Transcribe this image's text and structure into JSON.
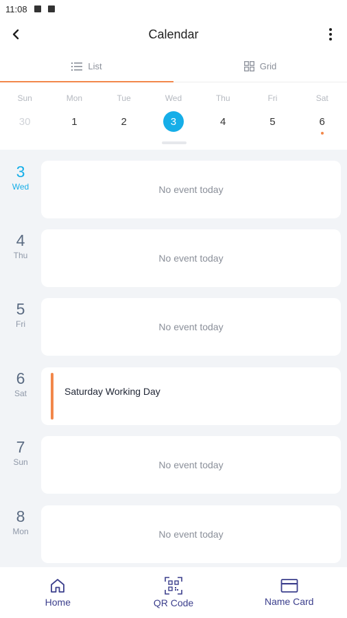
{
  "status_bar": {
    "time": "11:08"
  },
  "header": {
    "title": "Calendar"
  },
  "view_tabs": [
    {
      "label": "List",
      "icon": "list-icon",
      "active": true
    },
    {
      "label": "Grid",
      "icon": "grid-icon",
      "active": false
    }
  ],
  "week_strip": {
    "days": [
      {
        "name": "Sun",
        "date": "30",
        "muted": true
      },
      {
        "name": "Mon",
        "date": "1"
      },
      {
        "name": "Tue",
        "date": "2"
      },
      {
        "name": "Wed",
        "date": "3",
        "selected": true
      },
      {
        "name": "Thu",
        "date": "4"
      },
      {
        "name": "Fri",
        "date": "5"
      },
      {
        "name": "Sat",
        "date": "6",
        "has_event": true
      }
    ]
  },
  "agenda": [
    {
      "num": "3",
      "weekday": "Wed",
      "current": true,
      "text": "No event today"
    },
    {
      "num": "4",
      "weekday": "Thu",
      "text": "No event today"
    },
    {
      "num": "5",
      "weekday": "Fri",
      "text": "No event today"
    },
    {
      "num": "6",
      "weekday": "Sat",
      "event": "Saturday Working Day"
    },
    {
      "num": "7",
      "weekday": "Sun",
      "text": "No event today"
    },
    {
      "num": "8",
      "weekday": "Mon",
      "text": "No event today"
    }
  ],
  "bottom_nav": [
    {
      "label": "Home",
      "icon": "home-icon"
    },
    {
      "label": "QR Code",
      "icon": "qr-code-icon"
    },
    {
      "label": "Name Card",
      "icon": "name-card-icon"
    }
  ],
  "colors": {
    "accent": "#16aee8",
    "event": "#f2874a",
    "nav": "#3b3e8c"
  }
}
